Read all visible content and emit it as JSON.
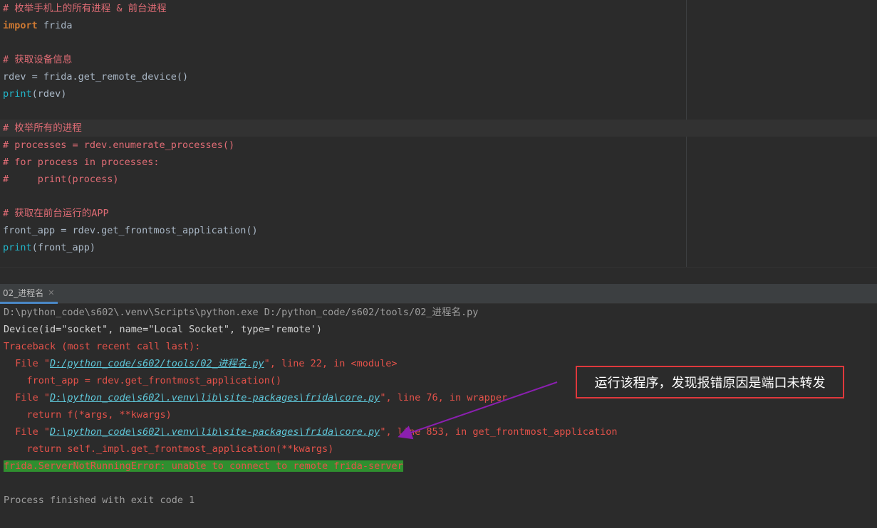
{
  "editor": {
    "lines": [
      {
        "segments": [
          {
            "c": "cm",
            "t": "# 枚举手机上的所有进程 & 前台进程"
          }
        ]
      },
      {
        "segments": [
          {
            "c": "kw",
            "t": "import"
          },
          {
            "c": "id",
            "t": " frida"
          }
        ]
      },
      {
        "segments": []
      },
      {
        "segments": [
          {
            "c": "cm",
            "t": "# 获取设备信息"
          }
        ]
      },
      {
        "segments": [
          {
            "c": "id",
            "t": "rdev = frida.get_remote_device()"
          }
        ]
      },
      {
        "segments": [
          {
            "c": "bi",
            "t": "print"
          },
          {
            "c": "pu",
            "t": "(rdev)"
          }
        ]
      },
      {
        "segments": []
      },
      {
        "segments": [
          {
            "c": "cm",
            "t": "# 枚举所有的进程"
          }
        ],
        "current": true
      },
      {
        "segments": [
          {
            "c": "cm",
            "t": "# processes = rdev.enumerate_processes()"
          }
        ]
      },
      {
        "segments": [
          {
            "c": "cm",
            "t": "# for process in processes:"
          }
        ]
      },
      {
        "segments": [
          {
            "c": "cm",
            "t": "#     print(process)"
          }
        ]
      },
      {
        "segments": []
      },
      {
        "segments": [
          {
            "c": "cm",
            "t": "# 获取在前台运行的APP"
          }
        ]
      },
      {
        "segments": [
          {
            "c": "id",
            "t": "front_app = rdev.get_frontmost_application()"
          }
        ]
      },
      {
        "segments": [
          {
            "c": "bi",
            "t": "print"
          },
          {
            "c": "pu",
            "t": "(front_app)"
          }
        ]
      }
    ]
  },
  "run_panel": {
    "tab_label": "02_进程名",
    "tab_close": "✕"
  },
  "console": {
    "lines": [
      {
        "segments": [
          {
            "c": "gray",
            "t": "D:\\python_code\\s602\\.venv\\Scripts\\python.exe D:/python_code/s602/tools/02_进程名.py"
          }
        ]
      },
      {
        "segments": [
          {
            "c": "white",
            "t": "Device(id=\"socket\", name=\"Local Socket\", type='remote')"
          }
        ]
      },
      {
        "segments": [
          {
            "c": "red",
            "t": "Traceback (most recent call last):"
          }
        ]
      },
      {
        "segments": [
          {
            "c": "red",
            "t": "  File \""
          },
          {
            "c": "link",
            "t": "D:/python_code/s602/tools/02_进程名.py"
          },
          {
            "c": "red",
            "t": "\", line 22, in <module>"
          }
        ]
      },
      {
        "segments": [
          {
            "c": "red",
            "t": "    front_app = rdev.get_frontmost_application()"
          }
        ]
      },
      {
        "segments": [
          {
            "c": "red",
            "t": "  File \""
          },
          {
            "c": "link",
            "t": "D:\\python_code\\s602\\.venv\\lib\\site-packages\\frida\\core.py"
          },
          {
            "c": "red",
            "t": "\", line 76, in wrapper"
          }
        ]
      },
      {
        "segments": [
          {
            "c": "red",
            "t": "    return f(*args, **kwargs)"
          }
        ]
      },
      {
        "segments": [
          {
            "c": "red",
            "t": "  File \""
          },
          {
            "c": "link",
            "t": "D:\\python_code\\s602\\.venv\\lib\\site-packages\\frida\\core.py"
          },
          {
            "c": "red",
            "t": "\", line 853, in get_frontmost_application"
          }
        ]
      },
      {
        "segments": [
          {
            "c": "red",
            "t": "    return self._impl.get_frontmost_application(**kwargs)"
          }
        ]
      },
      {
        "segments": [
          {
            "c": "err-hl",
            "t": "frida.ServerNotRunningError: unable to connect to remote frida-server"
          }
        ]
      },
      {
        "segments": []
      },
      {
        "segments": [
          {
            "c": "gray",
            "t": "Process finished with exit code 1"
          }
        ]
      }
    ]
  },
  "annotation": {
    "text": "运行该程序，发现报错原因是端口未转发",
    "border_color": "#e0383c",
    "arrow_color": "#8b1fb0"
  }
}
